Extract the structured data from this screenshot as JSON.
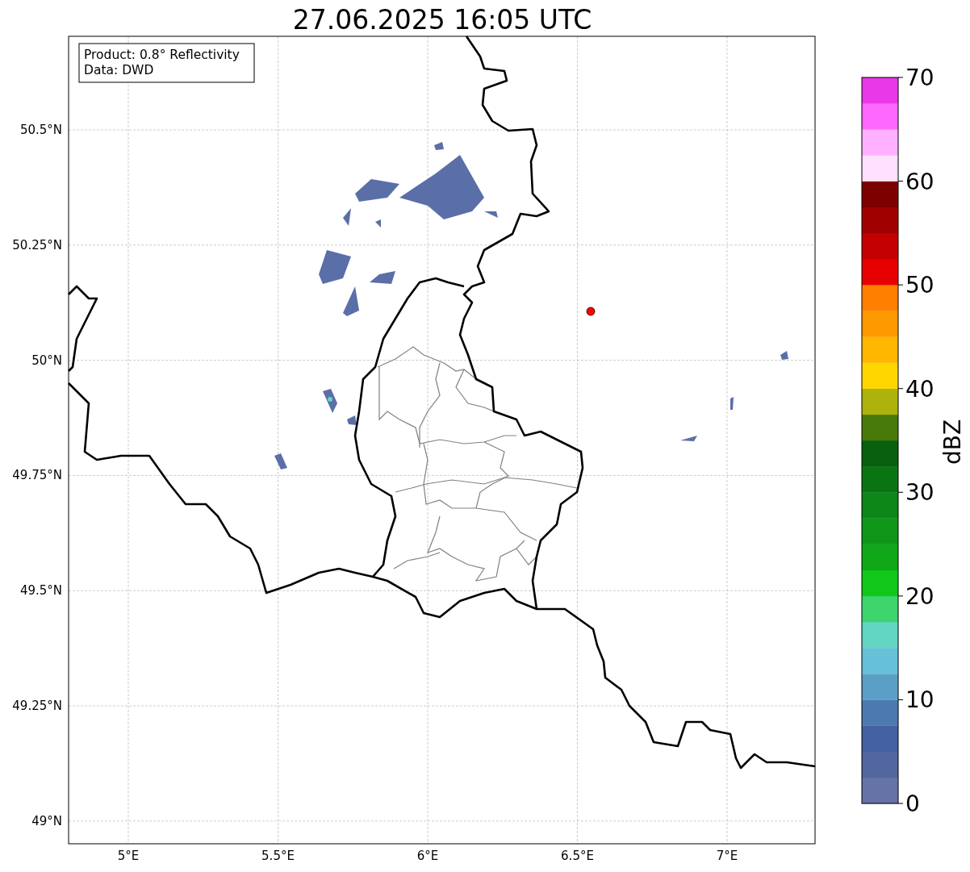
{
  "title": "27.06.2025 16:05 UTC",
  "info_box": {
    "lines": [
      "Product: 0.8° Reflectivity",
      "Data: DWD"
    ]
  },
  "map": {
    "x_ticks": [
      "5°E",
      "5.5°E",
      "6°E",
      "6.5°E",
      "7°E"
    ],
    "y_ticks": [
      "50.5°N",
      "50.25°N",
      "50°N",
      "49.75°N",
      "49.5°N",
      "49.25°N",
      "49°N"
    ]
  },
  "colorbar": {
    "label": "dBZ",
    "ticks": [
      "70",
      "60",
      "50",
      "40",
      "30",
      "20",
      "10",
      "0"
    ],
    "segments": [
      {
        "color": "#6573a6"
      },
      {
        "color": "#52669f"
      },
      {
        "color": "#4360a0"
      },
      {
        "color": "#4a7ab0"
      },
      {
        "color": "#5b9fc6"
      },
      {
        "color": "#66c0d8"
      },
      {
        "color": "#62d6c3"
      },
      {
        "color": "#3ed46e"
      },
      {
        "color": "#10c81a"
      },
      {
        "color": "#10a818"
      },
      {
        "color": "#0e9618"
      },
      {
        "color": "#0c8616"
      },
      {
        "color": "#0a7412"
      },
      {
        "color": "#085f0d"
      },
      {
        "color": "#487a0a"
      },
      {
        "color": "#adb30a"
      },
      {
        "color": "#ffd700"
      },
      {
        "color": "#ffb700"
      },
      {
        "color": "#ff9900"
      },
      {
        "color": "#ff7f00"
      },
      {
        "color": "#e60000"
      },
      {
        "color": "#c40000"
      },
      {
        "color": "#a00000"
      },
      {
        "color": "#7c0000"
      },
      {
        "color": "#ffe0ff"
      },
      {
        "color": "#ffb0ff"
      },
      {
        "color": "#ff68ff"
      },
      {
        "color": "#e838e8"
      }
    ]
  }
}
